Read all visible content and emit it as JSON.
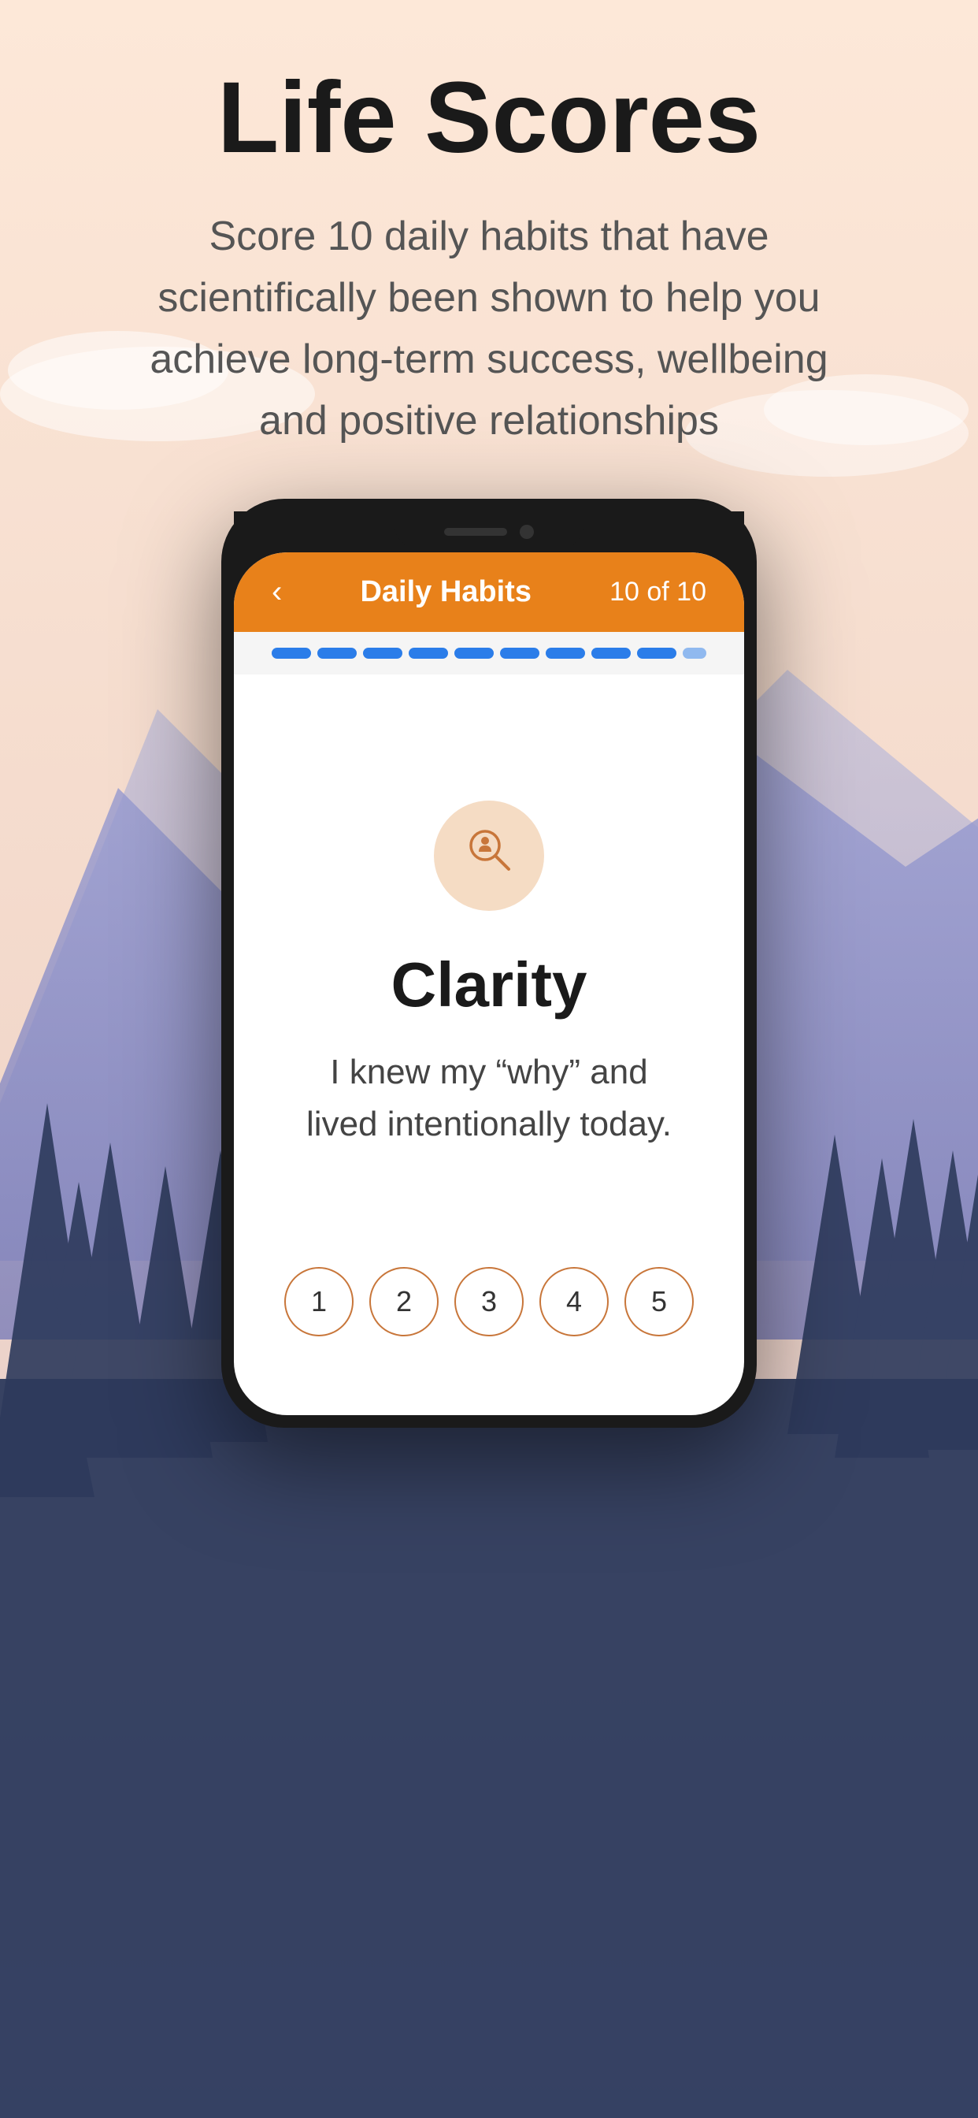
{
  "page": {
    "background_color": "#fde8d8",
    "title": "Life Scores",
    "subtitle": "Score 10 daily habits that have scientifically been shown to help you achieve long-term success, wellbeing and positive relationships"
  },
  "header": {
    "back_label": "‹",
    "title": "Daily Habits",
    "count": "10 of 10",
    "background_color": "#E8811A"
  },
  "progress": {
    "dots": [
      {
        "active": true
      },
      {
        "active": true
      },
      {
        "active": true
      },
      {
        "active": true
      },
      {
        "active": true
      },
      {
        "active": true
      },
      {
        "active": true
      },
      {
        "active": true
      },
      {
        "active": true
      },
      {
        "active": false
      }
    ]
  },
  "card": {
    "icon": "🔍",
    "title": "Clarity",
    "description": "I knew my “why” and lived intentionally today.",
    "scores": [
      {
        "label": "1"
      },
      {
        "label": "2"
      },
      {
        "label": "3"
      },
      {
        "label": "4"
      },
      {
        "label": "5"
      }
    ]
  }
}
